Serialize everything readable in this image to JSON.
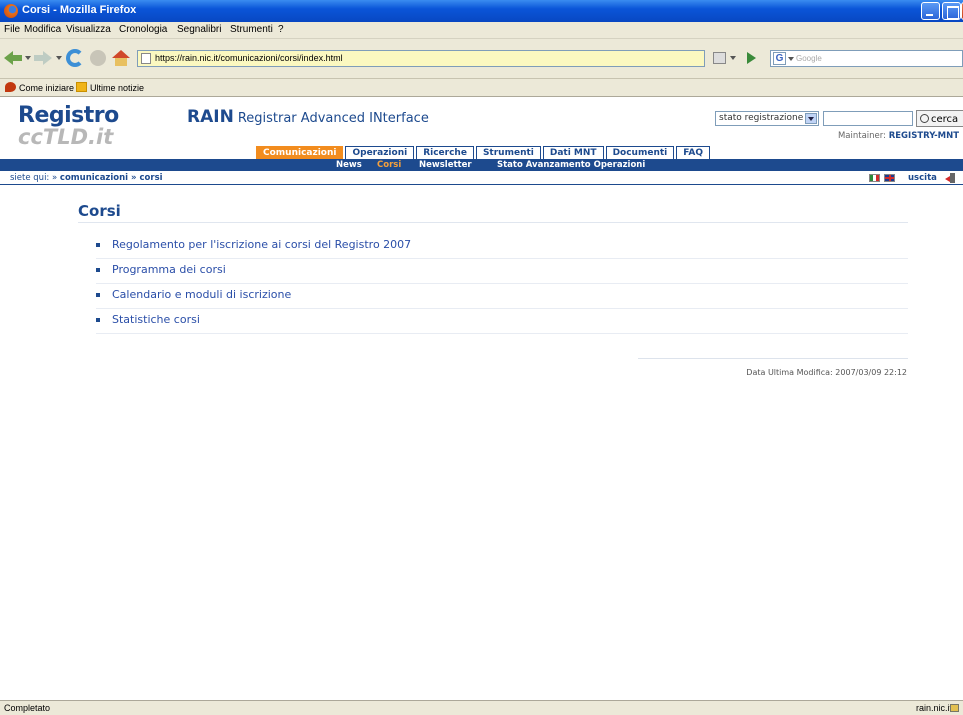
{
  "window": {
    "title": "Corsi - Mozilla Firefox"
  },
  "menu": [
    "File",
    "Modifica",
    "Visualizza",
    "Cronologia",
    "Segnalibri",
    "Strumenti",
    "?"
  ],
  "urlbar": {
    "url": "https://rain.nic.it/comunicazioni/corsi/index.html"
  },
  "websearch": {
    "placeholder": "Google",
    "engine_icon": "G"
  },
  "bookmarks": [
    {
      "label": "Come iniziare",
      "icon": "firefox-bookmark-icon"
    },
    {
      "label": "Ultime notizie",
      "icon": "rss-folder-icon"
    }
  ],
  "site": {
    "logo_line1": "Registro",
    "logo_line2": "ccTLD.it",
    "app_name": "RAIN",
    "app_subtitle": "Registrar Advanced INterface",
    "status_select": "stato registrazione",
    "search_button": "cerca",
    "maintainer_label": "Maintainer:",
    "maintainer_value": "REGISTRY-MNT"
  },
  "tabs": [
    "Comunicazioni",
    "Operazioni",
    "Ricerche",
    "Strumenti",
    "Dati MNT",
    "Documenti",
    "FAQ"
  ],
  "active_tab": "Comunicazioni",
  "subnav": [
    "News",
    "Corsi",
    "Newsletter",
    "Stato Avanzamento Operazioni"
  ],
  "active_subnav": "Corsi",
  "breadcrumb": {
    "prefix": "siete qui: » ",
    "path": "comunicazioni » corsi"
  },
  "logout": "uscita",
  "page": {
    "title": "Corsi",
    "items": [
      "Regolamento per l'iscrizione ai corsi del Registro 2007",
      "Programma dei corsi",
      "Calendario e moduli di iscrizione",
      "Statistiche corsi"
    ],
    "last_modified": "Data Ultima Modifica: 2007/03/09 22:12"
  },
  "statusbar": {
    "status": "Completato",
    "host": "rain.nic.it"
  },
  "colors": {
    "brand_blue": "#1d4a8e",
    "accent_orange": "#f28c1e",
    "link": "#2a4ea8"
  }
}
